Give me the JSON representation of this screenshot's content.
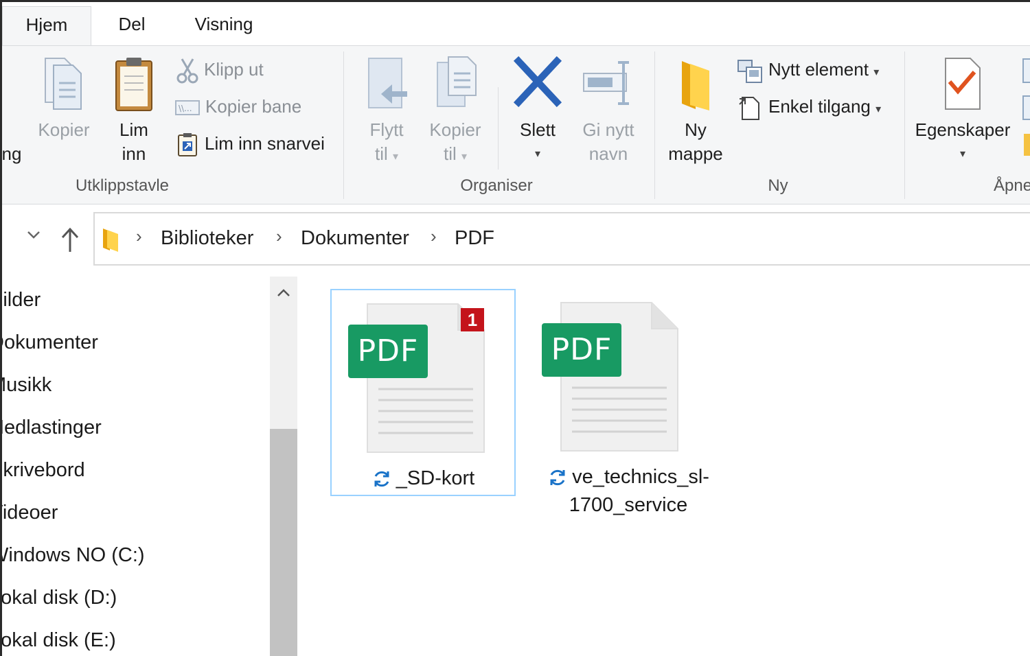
{
  "tabs": [
    {
      "label": "Hjem"
    },
    {
      "label": "Del"
    },
    {
      "label": "Visning"
    }
  ],
  "ribbon": {
    "clipboard": {
      "cut_label_partial": "ng",
      "copy": "Kopier",
      "paste_line1": "Lim",
      "paste_line2": "inn",
      "cut": "Klipp ut",
      "copy_path": "Kopier bane",
      "paste_shortcut": "Lim inn snarvei",
      "group_label": "Utklippstavle"
    },
    "organize": {
      "move_line1": "Flytt",
      "move_line2": "til",
      "copy_line1": "Kopier",
      "copy_line2": "til",
      "delete": "Slett",
      "rename_line1": "Gi nytt",
      "rename_line2": "navn",
      "group_label": "Organiser"
    },
    "new": {
      "folder_line1": "Ny",
      "folder_line2": "mappe",
      "new_item": "Nytt element",
      "easy_access": "Enkel tilgang",
      "group_label": "Ny"
    },
    "open": {
      "properties": "Egenskaper",
      "group_label_partial": "Åpne"
    }
  },
  "address": {
    "crumbs": [
      "Biblioteker",
      "Dokumenter",
      "PDF"
    ],
    "separator": "›"
  },
  "sidebar": {
    "items": [
      {
        "label": "Bilder"
      },
      {
        "label": "Dokumenter"
      },
      {
        "label": "Musikk"
      },
      {
        "label": "Nedlastinger"
      },
      {
        "label": "Skrivebord"
      },
      {
        "label": "Videoer"
      },
      {
        "label": "Windows NO (C:)"
      },
      {
        "label": "Lokal disk (D:)"
      },
      {
        "label": "Lokal disk (E:)"
      }
    ]
  },
  "files": [
    {
      "badge": "PDF",
      "count": "1",
      "name": "_SD-kort",
      "selected": true
    },
    {
      "badge": "PDF",
      "name_line1": "ve_technics_sl-",
      "name_line2": "1700_service",
      "selected": false
    }
  ],
  "colors": {
    "pdf_green": "#189a63",
    "badge_red": "#c4141b",
    "selection_border": "#99d1ff",
    "sync_blue": "#1a73c8",
    "delete_blue": "#2b63b8"
  }
}
